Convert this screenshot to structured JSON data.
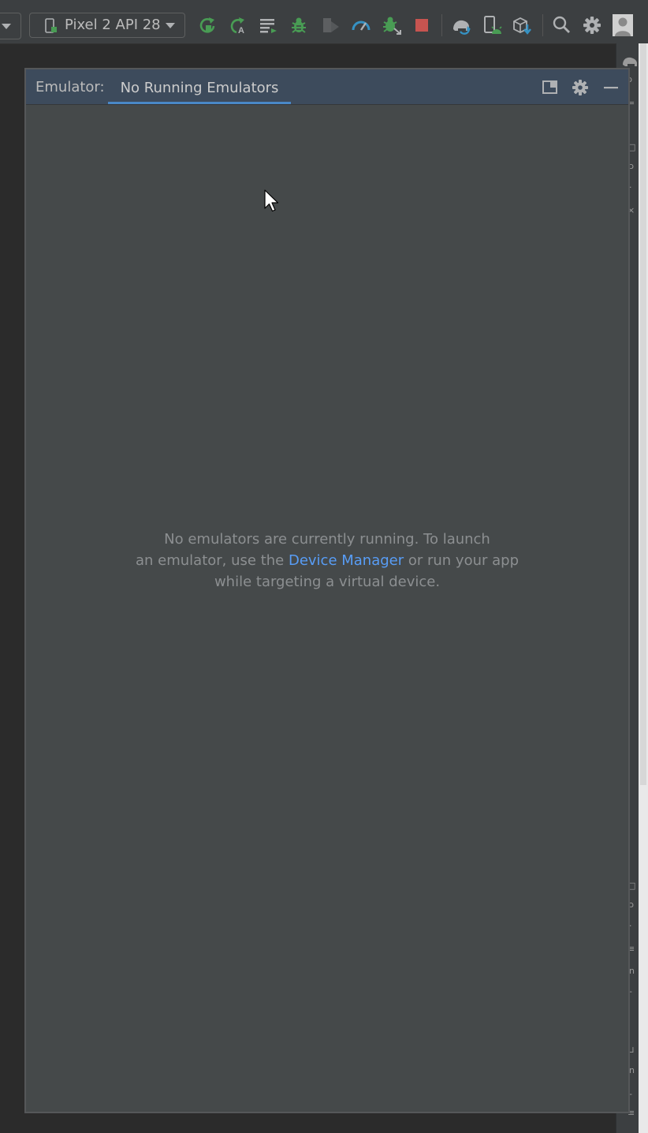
{
  "toolbar": {
    "device_select": {
      "label": "Pixel 2 API 28",
      "icon": "phone-device-icon"
    },
    "buttons": [
      {
        "name": "apply-changes-restart-activity-button",
        "icon": "apply-changes-icon"
      },
      {
        "name": "apply-code-changes-button",
        "icon": "apply-code-icon"
      },
      {
        "name": "run-configurations-button",
        "icon": "run-list-icon"
      },
      {
        "name": "debug-button",
        "icon": "bug-icon"
      },
      {
        "name": "run-with-coverage-button",
        "icon": "coverage-icon"
      },
      {
        "name": "profile-button",
        "icon": "gauge-icon"
      },
      {
        "name": "attach-debugger-button",
        "icon": "attach-bug-icon"
      },
      {
        "name": "stop-button",
        "icon": "stop-icon"
      },
      {
        "name": "sync-project-button",
        "icon": "elephant-sync-icon"
      },
      {
        "name": "device-manager-button",
        "icon": "device-manager-icon"
      },
      {
        "name": "sdk-manager-button",
        "icon": "sdk-download-icon"
      },
      {
        "name": "search-button",
        "icon": "search-icon"
      },
      {
        "name": "settings-button",
        "icon": "gear-icon"
      },
      {
        "name": "account-button",
        "icon": "user-avatar-icon"
      }
    ]
  },
  "emulator_panel": {
    "title": "Emulator:",
    "tab_label": "No Running Emulators",
    "header_buttons": [
      "layout-icon",
      "gear-icon",
      "minimize-icon"
    ],
    "message": {
      "line1": "No emulators are currently running. To launch",
      "line2_before": "an emulator, use the ",
      "link": "Device Manager",
      "line2_after": " or run your app",
      "line3": "while targeting a virtual device."
    }
  },
  "colors": {
    "toolbar_bg": "#3c3f41",
    "panel_bg": "#45494a",
    "panel_header_bg": "#3d4b5c",
    "tab_underline": "#4a88c7",
    "link": "#589df6",
    "message_text": "#8c8f91",
    "run_green": "#499c54",
    "stop_red": "#c75450",
    "accent_blue": "#3592c4"
  }
}
